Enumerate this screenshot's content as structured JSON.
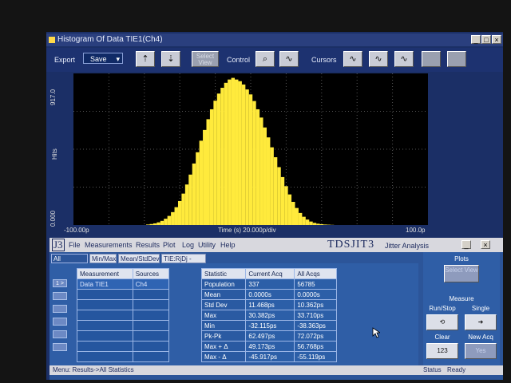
{
  "histogram_window": {
    "title": "Histogram Of Data TIE1(Ch4)",
    "toolbar": {
      "export_label": "Export",
      "save_value": "Save",
      "select_view_label": "Select View",
      "control_label": "Control",
      "cursors_label": "Cursors"
    },
    "plot": {
      "y_label": "Hits",
      "y_max": "917.0",
      "y_min": "0.000",
      "x_min": "-100.00p",
      "x_center": "Time (s)   20.000p/div",
      "x_max": "100.0p",
      "bar_color": "#ffea3c"
    }
  },
  "chart_data": {
    "type": "bar",
    "title": "Histogram Of Data TIE1(Ch4)",
    "xlabel": "Time (s)",
    "ylabel": "Hits",
    "xlim": [
      -100,
      100
    ],
    "ylim": [
      0,
      917
    ],
    "x_units": "ps",
    "bin_centers": [
      -58,
      -56,
      -54,
      -52,
      -50,
      -48,
      -46,
      -44,
      -42,
      -40,
      -38,
      -36,
      -34,
      -32,
      -30,
      -28,
      -26,
      -24,
      -22,
      -20,
      -18,
      -16,
      -14,
      -12,
      -10,
      -8,
      -6,
      -4,
      -2,
      0,
      2,
      4,
      6,
      8,
      10,
      12,
      14,
      16,
      18,
      20,
      22,
      24,
      26,
      28,
      30,
      32,
      34,
      36,
      38,
      40,
      42,
      44,
      46
    ],
    "values": [
      3,
      6,
      10,
      16,
      25,
      38,
      55,
      78,
      108,
      145,
      190,
      245,
      305,
      372,
      440,
      510,
      575,
      640,
      700,
      752,
      795,
      830,
      860,
      880,
      890,
      880,
      870,
      850,
      820,
      790,
      750,
      700,
      650,
      590,
      530,
      470,
      410,
      350,
      290,
      235,
      185,
      140,
      103,
      73,
      50,
      33,
      21,
      13,
      8,
      5,
      3,
      2,
      1
    ]
  },
  "jitter_window": {
    "logo": "J3",
    "menu": [
      "File",
      "Measurements",
      "Results",
      "Plot",
      "Log",
      "Utility",
      "Help"
    ],
    "brand": "TDSJIT3",
    "subtitle": "Jitter Analysis",
    "tabs": [
      "All Statistics",
      "Min/Max",
      "Mean/StdDev",
      "TIE:RjDj - BER"
    ],
    "side_buttons": [
      "1 >"
    ],
    "measure_table": {
      "headers": [
        "Measurement",
        "Sources"
      ],
      "rows": [
        [
          "Data TIE1",
          "Ch4"
        ]
      ]
    },
    "stats_table": {
      "headers": [
        "Statistic",
        "Current Acq",
        "All Acqs"
      ],
      "rows": [
        [
          "Population",
          "337",
          "56785"
        ],
        [
          "Mean",
          "0.0000s",
          "0.0000s"
        ],
        [
          "Std Dev",
          "11.468ps",
          "10.362ps"
        ],
        [
          "Max",
          "30.382ps",
          "33.710ps"
        ],
        [
          "Min",
          "-32.115ps",
          "-38.363ps"
        ],
        [
          "Pk-Pk",
          "62.497ps",
          "72.072ps"
        ],
        [
          "Max + Δ",
          "49.173ps",
          "56.768ps"
        ],
        [
          "Max - Δ",
          "-45.917ps",
          "-55.119ps"
        ]
      ]
    },
    "right_panel": {
      "plots_label": "Plots",
      "select_view": "Select View",
      "measure_label": "Measure",
      "run_stop": "Run/Stop",
      "single": "Single",
      "clear": "Clear",
      "clear_counter": "123",
      "new_acq": "New Acq",
      "yes": "Yes"
    },
    "status": {
      "menu_path": "Menu: Results->All Statistics",
      "status_label": "Status",
      "status_value": "Ready"
    }
  }
}
